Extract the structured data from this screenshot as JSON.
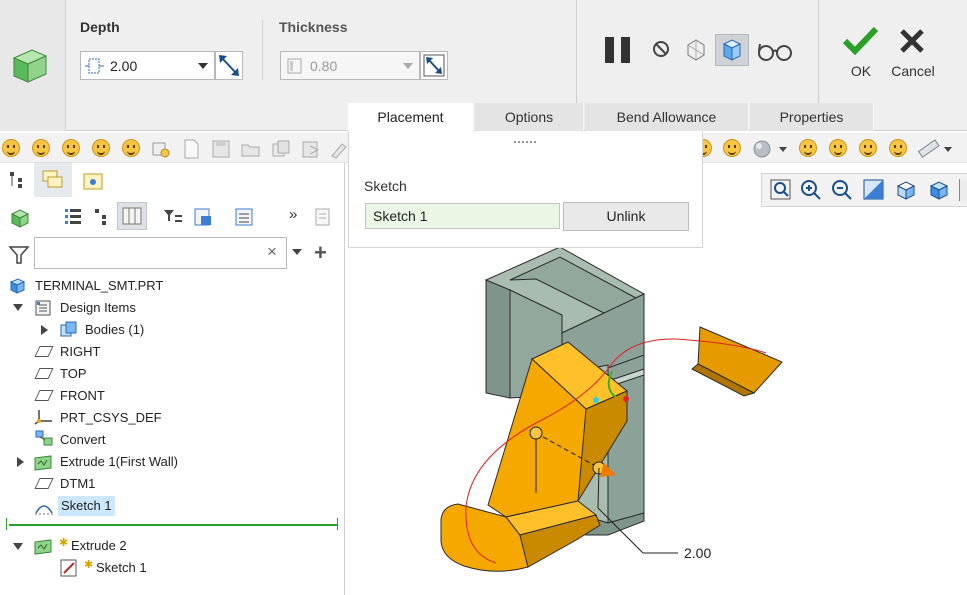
{
  "dashboard": {
    "depth_label": "Depth",
    "depth_value": "2.00",
    "thickness_label": "Thickness",
    "thickness_value": "0.80",
    "ok_label": "OK",
    "cancel_label": "Cancel",
    "tabs": [
      {
        "label": "Placement",
        "active": true
      },
      {
        "label": "Options"
      },
      {
        "label": "Bend Allowance"
      },
      {
        "label": "Properties"
      }
    ]
  },
  "placement": {
    "section_label": "Sketch",
    "sketch_value": "Sketch 1",
    "unlink_label": "Unlink"
  },
  "search": {
    "placeholder": ""
  },
  "tree": {
    "items": [
      {
        "label": "TERMINAL_SMT.PRT",
        "icon": "part-icon"
      },
      {
        "label": "Design Items",
        "icon": "design-items-icon"
      },
      {
        "label": "Bodies (1)",
        "icon": "bodies-icon"
      },
      {
        "label": "RIGHT",
        "icon": "datum-plane-icon"
      },
      {
        "label": "TOP",
        "icon": "datum-plane-icon"
      },
      {
        "label": "FRONT",
        "icon": "datum-plane-icon"
      },
      {
        "label": "PRT_CSYS_DEF",
        "icon": "csys-icon"
      },
      {
        "label": "Convert",
        "icon": "convert-icon"
      },
      {
        "label": "Extrude 1(First Wall)",
        "icon": "extrude-icon"
      },
      {
        "label": "DTM1",
        "icon": "datum-plane-icon"
      },
      {
        "label": "Sketch 1",
        "icon": "sketch-icon"
      },
      {
        "label": "Extrude 2",
        "icon": "extrude-icon"
      },
      {
        "label": "Sketch 1",
        "icon": "sketch-icon"
      }
    ]
  },
  "viewport": {
    "dimension_label": "2.00"
  },
  "colors": {
    "part_gray": "#9fb3a8",
    "part_orange": "#f6a600",
    "accent_green": "#2aa02a",
    "highlight": "#cce8ff"
  }
}
